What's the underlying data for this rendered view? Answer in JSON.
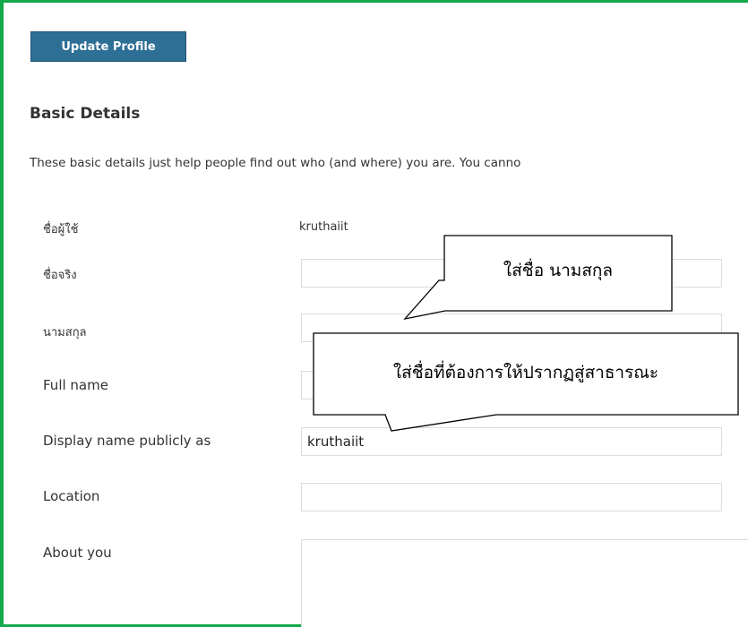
{
  "toolbar": {
    "update_label": "Update Profile"
  },
  "section": {
    "title": "Basic Details",
    "intro": "These basic details just help people find out who (and where) you are. You canno"
  },
  "fields": {
    "username_label": "ชื่อผู้ใช้",
    "username_value": "kruthaiit",
    "firstname_label": "ชื่อจริง",
    "firstname_value": "",
    "lastname_label": "นามสกุล",
    "lastname_value": "",
    "fullname_label": "Full name",
    "fullname_value": "",
    "display_label": "Display name publicly as",
    "display_value": "kruthaiit",
    "location_label": "Location",
    "location_value": "",
    "about_label": "About you",
    "about_value": ""
  },
  "callouts": {
    "name_hint": "ใส่ชื่อ นามสกุล",
    "display_hint": "ใส่ชื่อที่ต้องการให้ปรากฏสู่สาธารณะ"
  },
  "colors": {
    "frame_border": "#14a84a",
    "button_bg": "#2e6f95",
    "button_text": "#ffffff"
  }
}
